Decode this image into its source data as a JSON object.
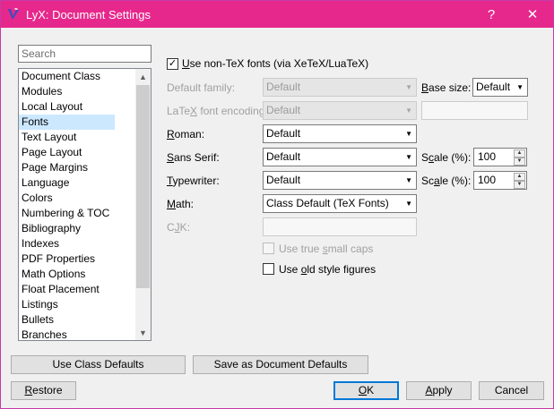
{
  "window": {
    "title": "LyX: Document Settings",
    "help_label": "?",
    "close_glyph": "✕"
  },
  "sidebar": {
    "search_placeholder": "Search",
    "items": [
      {
        "label": "Document Class"
      },
      {
        "label": "Modules"
      },
      {
        "label": "Local Layout"
      },
      {
        "label": "Fonts",
        "selected": true
      },
      {
        "label": "Text Layout"
      },
      {
        "label": "Page Layout"
      },
      {
        "label": "Page Margins"
      },
      {
        "label": "Language"
      },
      {
        "label": "Colors"
      },
      {
        "label": "Numbering & TOC"
      },
      {
        "label": "Bibliography"
      },
      {
        "label": "Indexes"
      },
      {
        "label": "PDF Properties"
      },
      {
        "label": "Math Options"
      },
      {
        "label": "Float Placement"
      },
      {
        "label": "Listings"
      },
      {
        "label": "Bullets"
      },
      {
        "label": "Branches"
      }
    ]
  },
  "fonts": {
    "use_nontex": {
      "pre": "",
      "key": "U",
      "rest": "se non-TeX fonts (via XeTeX/LuaTeX)",
      "checked": true
    },
    "default_family": {
      "label": "Default family:",
      "value": "Default"
    },
    "base_size": {
      "key": "B",
      "rest": "ase size:",
      "value": "Default"
    },
    "latex_encoding": {
      "pre": "LaTe",
      "key": "X",
      "rest": " font encoding:",
      "value": "Default",
      "field_value": ""
    },
    "roman": {
      "key": "R",
      "rest": "oman:",
      "value": "Default"
    },
    "sans_serif": {
      "key": "S",
      "rest": "ans Serif:",
      "value": "Default"
    },
    "typewriter": {
      "key": "T",
      "rest": "ypewriter:",
      "value": "Default"
    },
    "math": {
      "key": "M",
      "rest": "ath:",
      "value": "Class Default (TeX Fonts)"
    },
    "scale_sans": {
      "pre": "S",
      "key": "c",
      "rest": "ale (%):",
      "value": "100"
    },
    "scale_tt": {
      "pre": "Sc",
      "key": "a",
      "rest": "le (%):",
      "value": "100"
    },
    "cjk": {
      "pre": "C",
      "key": "J",
      "rest": "K:",
      "value": ""
    },
    "small_caps": {
      "pre": "Use true ",
      "key": "s",
      "rest": "mall caps",
      "checked": false
    },
    "old_style": {
      "pre": "Use ",
      "key": "o",
      "rest": "ld style figures",
      "checked": false
    }
  },
  "footer": {
    "use_class_defaults": "Use Class Defaults",
    "save_defaults": "Save as Document Defaults",
    "restore": {
      "key": "R",
      "rest": "estore"
    },
    "ok": {
      "key": "O",
      "rest": "K"
    },
    "apply": {
      "key": "A",
      "rest": "pply"
    },
    "cancel": "Cancel"
  },
  "glyphs": {
    "dropdown": "▼",
    "spin_up": "▲",
    "spin_down": "▼",
    "check": "✓",
    "scroll_up": "▲",
    "scroll_down": "▼"
  },
  "icons": {
    "app": "lyx-app-icon"
  },
  "colors": {
    "titlebar": "#e6288c",
    "selection": "#cce8ff",
    "default_button_border": "#0078d7"
  }
}
